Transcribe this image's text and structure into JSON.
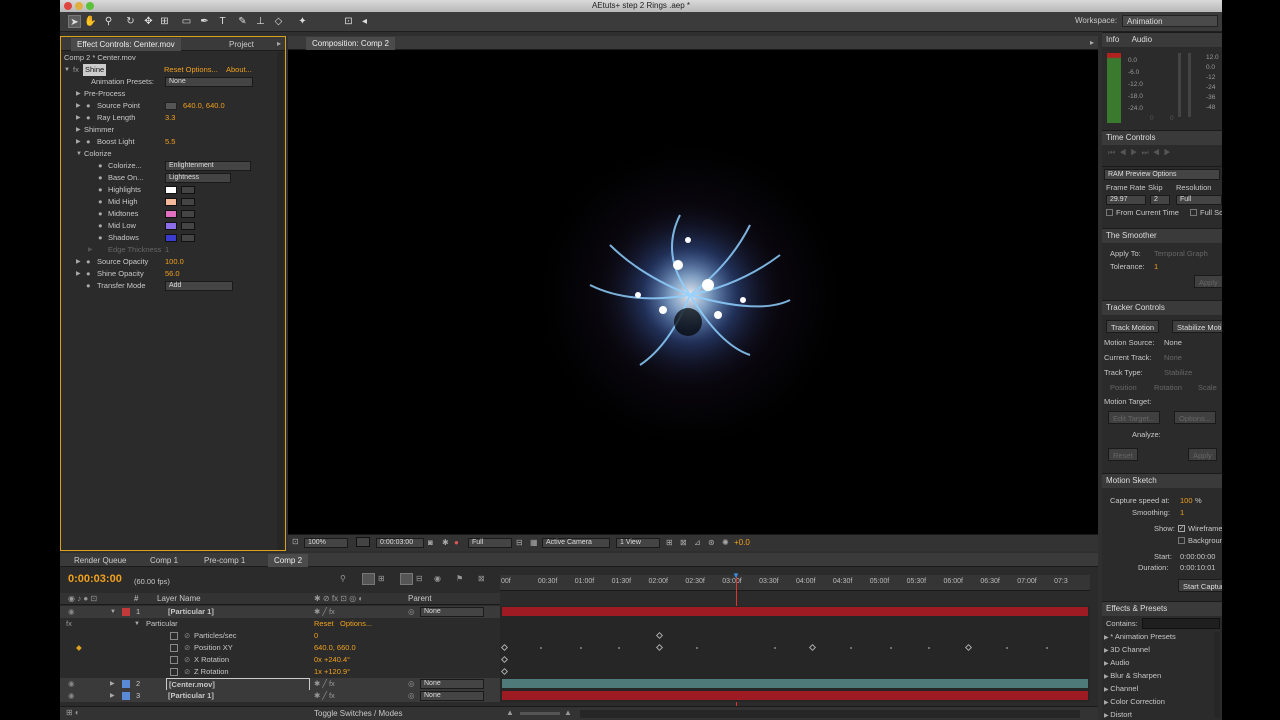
{
  "window": {
    "title": "AEtuts+ step 2 Rings .aep *"
  },
  "workspace": {
    "label": "Workspace:",
    "value": "Animation"
  },
  "effect_controls": {
    "tabs": [
      "Effect Controls: Center.mov",
      "Project"
    ],
    "breadcrumb": "Comp 2 * Center.mov",
    "fx_name": "Shine",
    "reset_link": "Reset Options...",
    "about_link": "About...",
    "presets_label": "Animation Presets:",
    "presets_value": "None",
    "props": {
      "preprocess": "Pre-Process",
      "source_point_label": "Source Point",
      "source_point_value": "640.0, 640.0",
      "ray_length_label": "Ray Length",
      "ray_length_value": "3.3",
      "shimmer": "Shimmer",
      "boost_light_label": "Boost Light",
      "boost_light_value": "5.5",
      "colorize": "Colorize",
      "colorize_sub_label": "Colorize...",
      "colorize_sub_value": "Enlightenment",
      "base_on_label": "Base On...",
      "base_on_value": "Lightness",
      "highlights": "Highlights",
      "mid_high": "Mid High",
      "midtones": "Midtones",
      "mid_low": "Mid Low",
      "shadows": "Shadows",
      "edge_thickness": "Edge Thickness",
      "edge_thickness_value": "1",
      "source_opacity_label": "Source Opacity",
      "source_opacity_value": "100.0",
      "shine_opacity_label": "Shine Opacity",
      "shine_opacity_value": "56.0",
      "transfer_mode_label": "Transfer Mode",
      "transfer_mode_value": "Add"
    },
    "colors": {
      "highlights": "#ffffff",
      "mid_high": "#f3b99a",
      "midtones": "#e06fbf",
      "mid_low": "#8b6ee8",
      "shadows": "#3b3bd0"
    }
  },
  "composition": {
    "tab": "Composition: Comp 2",
    "zoom": "100%",
    "timecode": "0:00:03:00",
    "resolution": "Full",
    "camera": "Active Camera",
    "view": "1 View",
    "exposure": "+0.0"
  },
  "info_panel": {
    "tabs": [
      "Info",
      "Audio"
    ],
    "audio_levels": [
      "0.0",
      "-6.0",
      "-12.0",
      "-18.0",
      "-24.0"
    ],
    "audio_right": [
      "12.0",
      "0.0",
      "-12",
      "-24",
      "-36",
      "-48"
    ],
    "zeroes": [
      "0",
      "0"
    ]
  },
  "time_controls": {
    "title": "Time Controls"
  },
  "ram_preview": {
    "title": "RAM Preview Options",
    "frame_rate_label": "Frame Rate",
    "skip_label": "Skip",
    "resolution_label": "Resolution",
    "frame_rate_value": "29.97",
    "skip_value": "2",
    "resolution_value": "Full",
    "from_current": "From Current Time",
    "full_screen": "Full Screen"
  },
  "smoother": {
    "title": "The Smoother",
    "apply_to_label": "Apply To:",
    "apply_to_value": "Temporal Graph",
    "tolerance_label": "Tolerance:",
    "tolerance_value": "1",
    "apply_button": "Apply"
  },
  "tracker": {
    "title": "Tracker Controls",
    "track_motion": "Track Motion",
    "stabilize_motion": "Stabilize Motion",
    "motion_source_label": "Motion Source:",
    "motion_source_value": "None",
    "current_track_label": "Current Track:",
    "current_track_value": "None",
    "track_type_label": "Track Type:",
    "track_type_value": "Stabilize",
    "opts": [
      "Position",
      "Rotation",
      "Scale"
    ],
    "motion_target_label": "Motion Target:",
    "edit_target": "Edit Target...",
    "options": "Options...",
    "analyze_label": "Analyze:",
    "reset": "Reset",
    "apply": "Apply"
  },
  "motion_sketch": {
    "title": "Motion Sketch",
    "capture_label": "Capture speed at:",
    "capture_value": "100",
    "capture_unit": "%",
    "smoothing_label": "Smoothing:",
    "smoothing_value": "1",
    "show_label": "Show:",
    "wireframe": "Wireframe",
    "background": "Background",
    "start_label": "Start:",
    "start_value": "0:00:00:00",
    "duration_label": "Duration:",
    "duration_value": "0:00:10:01",
    "start_capture": "Start Capture"
  },
  "effects_presets": {
    "title": "Effects & Presets",
    "contains_label": "Contains:",
    "items": [
      "* Animation Presets",
      "3D Channel",
      "Audio",
      "Blur & Sharpen",
      "Channel",
      "Color Correction",
      "Distort"
    ]
  },
  "timeline": {
    "tabs": [
      "Render Queue",
      "Comp 1",
      "Pre-comp 1",
      "Comp 2"
    ],
    "timecode": "0:00:03:00",
    "fps": "(60.00 fps)",
    "ruler": [
      "00f",
      "00:30f",
      "01:00f",
      "01:30f",
      "02:00f",
      "02:30f",
      "03:00f",
      "03:30f",
      "04:00f",
      "04:30f",
      "05:00f",
      "05:30f",
      "06:00f",
      "06:30f",
      "07:00f",
      "07:3"
    ],
    "columns": {
      "num": "#",
      "layer_name": "Layer Name",
      "parent": "Parent"
    },
    "layers": [
      {
        "num": "1",
        "name": "[Particular 1]",
        "parent": "None",
        "color": "#c23a3a"
      },
      {
        "num": "2",
        "name": "[Center.mov]",
        "parent": "None",
        "color": "#5a8ad6"
      },
      {
        "num": "3",
        "name": "[Particular 1]",
        "parent": "None",
        "color": "#5a8ad6"
      }
    ],
    "effect_name": "Particular",
    "effect_reset": "Reset",
    "effect_options": "Options...",
    "props": [
      {
        "label": "Particles/sec",
        "value": "0"
      },
      {
        "label": "Position XY",
        "value": "640.0, 660.0"
      },
      {
        "label": "X Rotation",
        "value": "0x +240.4°"
      },
      {
        "label": "Z Rotation",
        "value": "1x +120.9°"
      }
    ],
    "toggle_label": "Toggle Switches / Modes"
  }
}
